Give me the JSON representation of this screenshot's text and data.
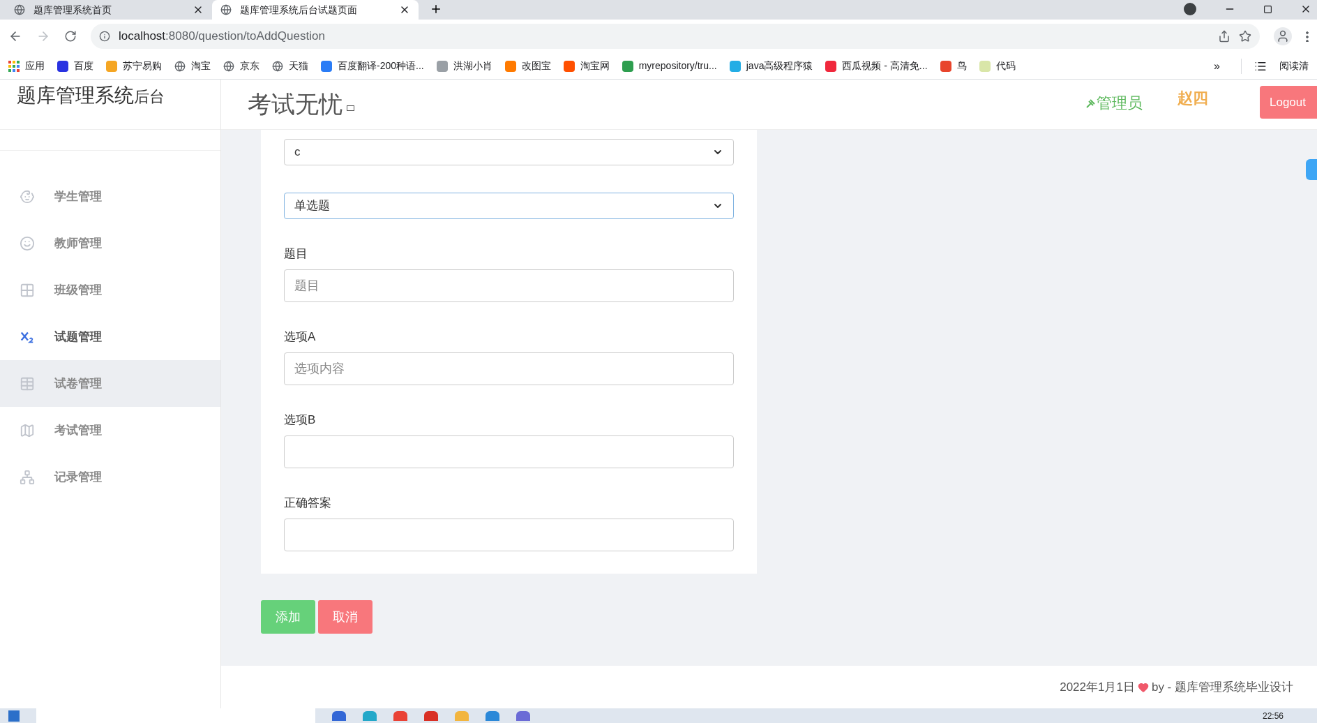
{
  "browser": {
    "tabs": [
      {
        "title": "题库管理系统首页",
        "selected": false
      },
      {
        "title": "题库管理系统后台试题页面",
        "selected": true
      }
    ],
    "url_host": "localhost",
    "url_rest": ":8080/question/toAddQuestion",
    "bookmarks": [
      {
        "label": "应用",
        "kind": "apps"
      },
      {
        "label": "百度",
        "kind": "badge",
        "color": "#2932e1"
      },
      {
        "label": "苏宁易购",
        "kind": "badge",
        "color": "#f5a623"
      },
      {
        "label": "淘宝",
        "kind": "globe"
      },
      {
        "label": "京东",
        "kind": "globe"
      },
      {
        "label": "天猫",
        "kind": "globe"
      },
      {
        "label": "百度翻译-200种语...",
        "kind": "badge",
        "color": "#2a7cf6"
      },
      {
        "label": "洪湖小肖",
        "kind": "badge",
        "color": "#9aa0a6"
      },
      {
        "label": "改图宝",
        "kind": "badge",
        "color": "#ff7a00"
      },
      {
        "label": "淘宝网",
        "kind": "badge",
        "color": "#ff5000"
      },
      {
        "label": "myrepository/tru...",
        "kind": "badge",
        "color": "#2e9e4f"
      },
      {
        "label": "java高级程序猿",
        "kind": "badge",
        "color": "#23ade5"
      },
      {
        "label": "西瓜视频 - 高清免...",
        "kind": "badge",
        "color": "#f0283c"
      },
      {
        "label": "鸟",
        "kind": "badge",
        "color": "#e8452c"
      },
      {
        "label": "代码",
        "kind": "badge",
        "color": "#d9e6a8"
      }
    ],
    "more": "»",
    "reading_list": "阅读清"
  },
  "header": {
    "logo": "题库管理系统",
    "logo_suffix": "后台",
    "brand": "考试无忧",
    "role": "管理员",
    "user": "赵四",
    "logout": "Logout"
  },
  "sidebar": {
    "items": [
      {
        "label": "学生管理",
        "kind": "baby",
        "selected": false,
        "hovered": false
      },
      {
        "label": "教师管理",
        "kind": "face",
        "selected": false,
        "hovered": false
      },
      {
        "label": "班级管理",
        "kind": "grid",
        "selected": false,
        "hovered": false
      },
      {
        "label": "试题管理",
        "kind": "subscript",
        "selected": true,
        "hovered": false
      },
      {
        "label": "试卷管理",
        "kind": "table",
        "selected": false,
        "hovered": true
      },
      {
        "label": "考试管理",
        "kind": "map",
        "selected": false,
        "hovered": false
      },
      {
        "label": "记录管理",
        "kind": "tree",
        "selected": false,
        "hovered": false
      }
    ]
  },
  "form": {
    "fields": [
      {
        "kind": "select",
        "value": "c",
        "focused": false
      },
      {
        "kind": "select",
        "value": "单选题",
        "focused": true
      },
      {
        "kind": "input",
        "label": "题目",
        "placeholder": "题目",
        "focused": false
      },
      {
        "kind": "input",
        "label": "选项A",
        "placeholder": "选项内容",
        "focused": false
      },
      {
        "kind": "input",
        "label": "选项B",
        "focused": false
      },
      {
        "kind": "input",
        "label": "正确答案",
        "focused": false
      }
    ],
    "buttons": [
      {
        "label": "添加",
        "kind": "primary"
      },
      {
        "label": "取消",
        "kind": "danger"
      }
    ]
  },
  "footer": {
    "date": "2022年1月1日",
    "by": "by - 题库管理系统毕业设计"
  },
  "taskbar": {
    "time": "22:56"
  }
}
